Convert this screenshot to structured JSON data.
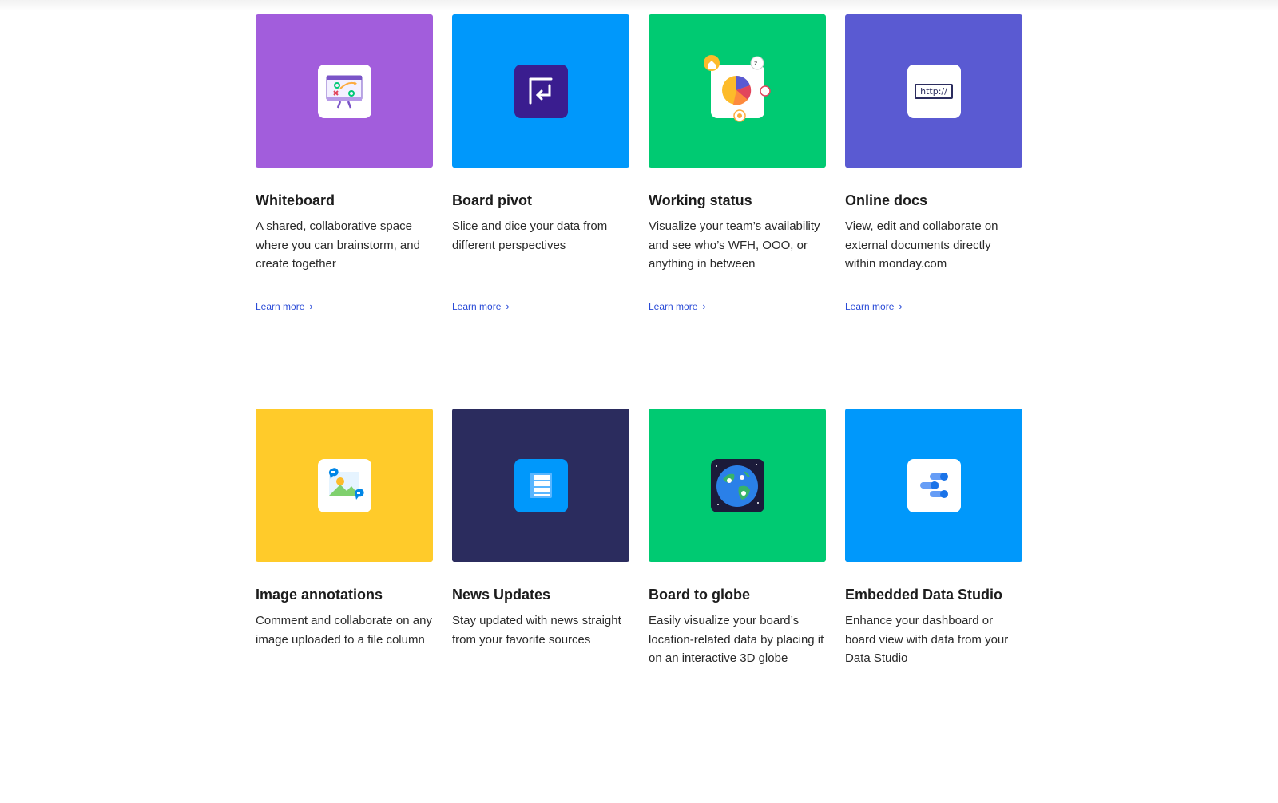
{
  "cards": [
    {
      "title": "Whiteboard",
      "desc": "A shared, collaborative space where you can brainstorm, and create together",
      "link": "Learn more",
      "color": "#a25ddc",
      "icon": "whiteboard-icon"
    },
    {
      "title": "Board pivot",
      "desc": "Slice and dice your data from different perspectives",
      "link": "Learn more",
      "color": "#0098fb",
      "icon": "pivot-icon"
    },
    {
      "title": "Working status",
      "desc": "Visualize your team’s availability and see who’s WFH, OOO, or anything in between",
      "link": "Learn more",
      "color": "#00ca72",
      "icon": "pie-status-icon"
    },
    {
      "title": "Online docs",
      "desc": "View, edit and collaborate on external documents directly within monday.com",
      "link": "Learn more",
      "color": "#5a5ad2",
      "icon": "url-doc-icon",
      "icon_text": "http://"
    },
    {
      "title": "Image annotations",
      "desc": "Comment and collaborate on any image uploaded to a file column",
      "color": "#ffcb2a",
      "icon": "image-annotation-icon"
    },
    {
      "title": "News Updates",
      "desc": "Stay updated with news straight from your favorite sources",
      "color": "#2b2c5e",
      "icon": "news-icon"
    },
    {
      "title": "Board to globe",
      "desc": "Easily visualize your board’s location-related data by placing it on an interactive 3D globe",
      "color": "#00ca72",
      "icon": "globe-icon"
    },
    {
      "title": "Embedded Data Studio",
      "desc": "Enhance your dashboard or board view with data from your Data Studio",
      "color": "#0098fb",
      "icon": "data-studio-icon"
    }
  ]
}
